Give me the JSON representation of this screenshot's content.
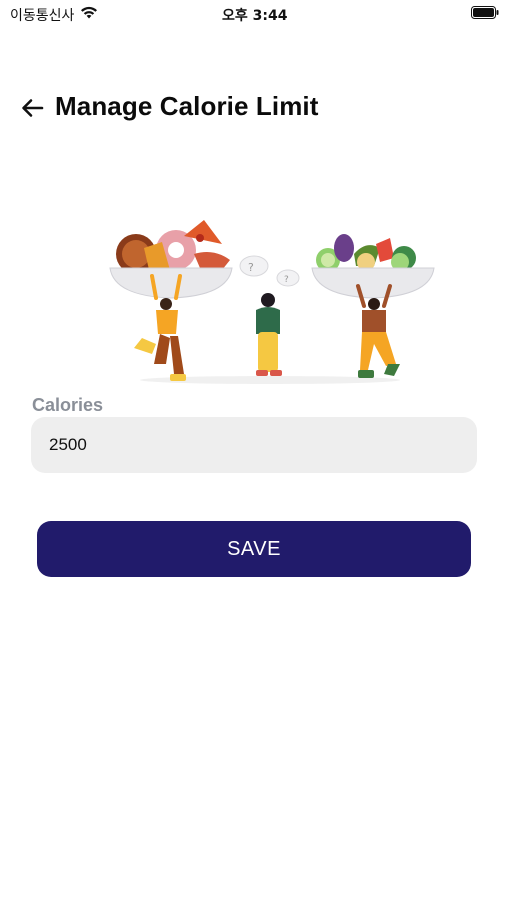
{
  "status_bar": {
    "carrier": "이동통신사",
    "time": "오후 3:44"
  },
  "header": {
    "title": "Manage Calorie Limit"
  },
  "form": {
    "label": "Calories",
    "value": "2500"
  },
  "actions": {
    "save_label": "SAVE"
  },
  "colors": {
    "primary_button": "#211b6b",
    "input_background": "#eeeeee",
    "label_gray": "#8a8f98"
  }
}
